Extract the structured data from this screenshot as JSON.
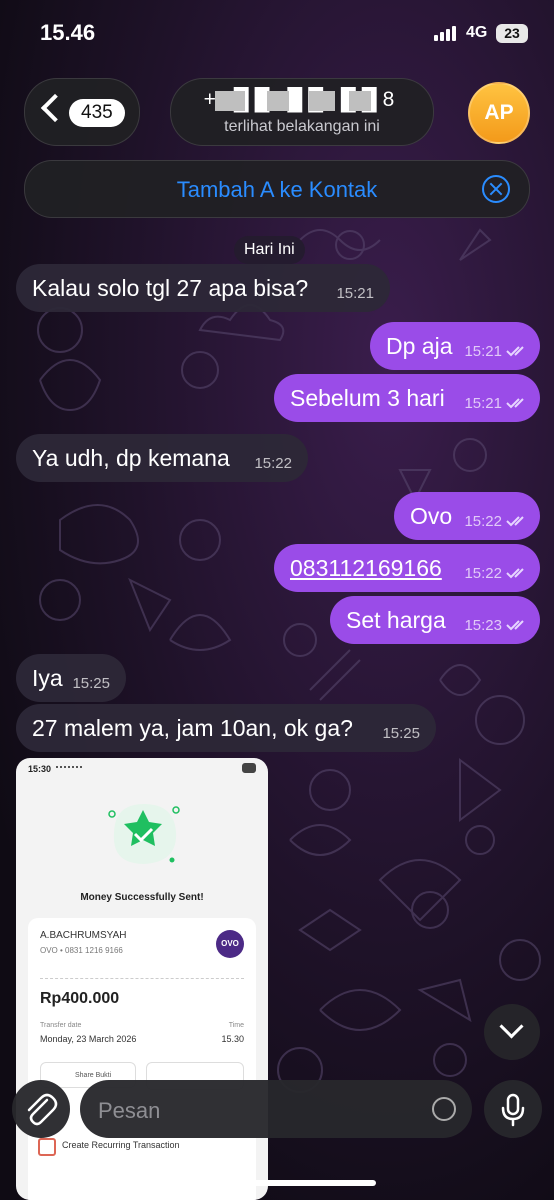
{
  "status": {
    "time": "15.46",
    "network": "4G",
    "battery": "23"
  },
  "header": {
    "back_count": "435",
    "contact_number": "+ ██ ██ ██8",
    "last_seen": "terlihat belakangan ini",
    "avatar_initials": "AP"
  },
  "add_contact": {
    "label": "Tambah A ke Kontak"
  },
  "day_label": "Hari Ini",
  "messages": [
    {
      "dir": "in",
      "text": "Kalau solo tgl 27 apa bisa?",
      "time": "15:21"
    },
    {
      "dir": "out",
      "text": "Dp aja",
      "time": "15:21"
    },
    {
      "dir": "out",
      "text": "Sebelum 3 hari",
      "time": "15:21"
    },
    {
      "dir": "in",
      "text": "Ya udh, dp kemana",
      "time": "15:22"
    },
    {
      "dir": "out",
      "text": "Ovo",
      "time": "15:22"
    },
    {
      "dir": "out",
      "text": "083112169166",
      "time": "15:22"
    },
    {
      "dir": "out",
      "text": "Set harga",
      "time": "15:23"
    },
    {
      "dir": "in",
      "text": "Iya",
      "time": "15:25"
    },
    {
      "dir": "in",
      "text": "27 malem ya, jam 10an, ok ga?",
      "time": "15:25"
    }
  ],
  "screenshot": {
    "time": "15:30",
    "heading": "Money Successfully Sent!",
    "recipient": "A.BACHRUMSYAH",
    "account": "OVO • 0831 1216 9166",
    "wallet_logo": "OVO",
    "amount": "Rp400.000",
    "date_label": "Transfer date",
    "date": "Monday, 23 March 2026",
    "time_label": "Time",
    "transfer_time": "15.30",
    "share_label": "Share Bukti",
    "recurring": "Create Recurring Transaction"
  },
  "composer": {
    "placeholder": "Pesan"
  },
  "icons": {
    "back": "chevron-left-icon",
    "close": "close-circle-icon",
    "attach": "paperclip-icon",
    "sticker": "sticker-icon",
    "mic": "microphone-icon",
    "scroll": "chevron-down-icon",
    "read": "double-check-icon"
  },
  "colors": {
    "outgoing": "#9a4ce8",
    "incoming": "#2d2837",
    "accent": "#2a8cff",
    "avatar": "#f5a623",
    "success": "#1fbf60"
  }
}
